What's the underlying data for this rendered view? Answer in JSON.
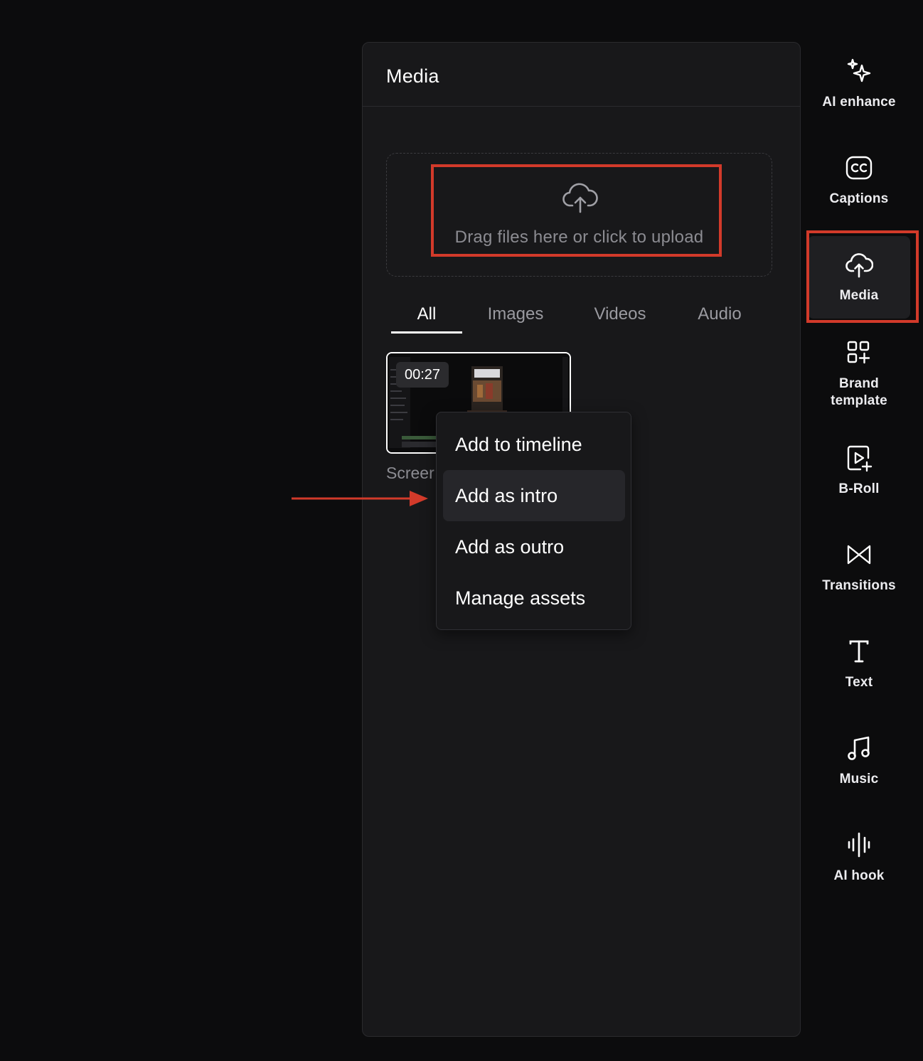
{
  "panel": {
    "title": "Media",
    "upload": {
      "text": "Drag files here or click to upload",
      "icon": "cloud-upload-icon"
    },
    "tabs": [
      {
        "label": "All",
        "active": true
      },
      {
        "label": "Images",
        "active": false
      },
      {
        "label": "Videos",
        "active": false
      },
      {
        "label": "Audio",
        "active": false
      }
    ],
    "media_item": {
      "duration": "00:27",
      "name": "Screer"
    },
    "context_menu": [
      {
        "label": "Add to timeline"
      },
      {
        "label": "Add as intro",
        "hovered": true
      },
      {
        "label": "Add as outro"
      },
      {
        "label": "Manage assets"
      }
    ]
  },
  "sidebar": {
    "items": [
      {
        "label": "AI enhance",
        "icon": "sparkle-icon"
      },
      {
        "label": "Captions",
        "icon": "cc-icon"
      },
      {
        "label": "Media",
        "icon": "cloud-upload-icon",
        "active": true
      },
      {
        "label": "Brand\ntemplate",
        "icon": "grid-plus-icon"
      },
      {
        "label": "B-Roll",
        "icon": "play-add-icon"
      },
      {
        "label": "Transitions",
        "icon": "transition-icon"
      },
      {
        "label": "Text",
        "icon": "text-icon"
      },
      {
        "label": "Music",
        "icon": "music-note-icon"
      },
      {
        "label": "AI hook",
        "icon": "audio-wave-icon"
      }
    ]
  },
  "colors": {
    "highlight": "#d23a2a",
    "panel_bg": "#18181a",
    "page_bg": "#0c0c0d"
  }
}
